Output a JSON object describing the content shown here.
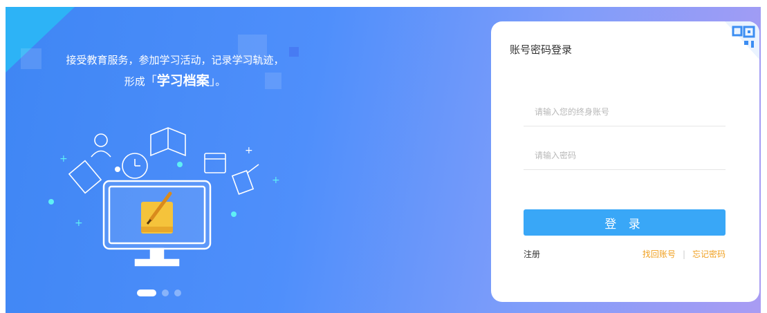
{
  "hero": {
    "slogan_line1": "接受教育服务，参加学习活动，记录学习轨迹，",
    "slogan_prefix": "形成",
    "slogan_highlight": "学习档案",
    "slogan_suffix": "。",
    "carousel_total": 3,
    "carousel_active": 1
  },
  "login": {
    "title": "账号密码登录",
    "account_placeholder": "请输入您的终身账号",
    "password_placeholder": "请输入密码",
    "submit_label": "登 录",
    "register_label": "注册",
    "find_account_label": "找回账号",
    "separator": "|",
    "forgot_password_label": "忘记密码"
  },
  "colors": {
    "accent": "#39a7f7",
    "link": "#f0a020"
  }
}
